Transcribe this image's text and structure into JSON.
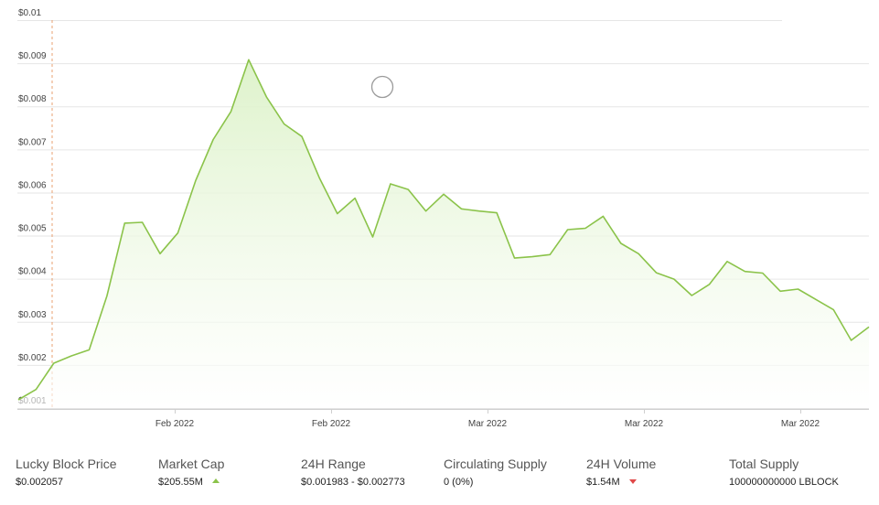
{
  "chart_data": {
    "type": "area",
    "title": "",
    "xlabel": "",
    "ylabel": "",
    "ylim": [
      0.001,
      0.01
    ],
    "y_ticks": [
      "$0.001",
      "$0.002",
      "$0.003",
      "$0.004",
      "$0.005",
      "$0.006",
      "$0.007",
      "$0.008",
      "$0.009",
      "$0.01"
    ],
    "x_ticks": [
      "Feb 2022",
      "Feb 2022",
      "Mar 2022",
      "Mar 2022",
      "Mar 2022"
    ],
    "grid": true,
    "series": [
      {
        "values": [
          0.00119,
          0.00143,
          0.00204,
          0.00221,
          0.00235,
          0.0036,
          0.00529,
          0.00531,
          0.00458,
          0.00506,
          0.00627,
          0.00723,
          0.00788,
          0.00908,
          0.00822,
          0.00759,
          0.0073,
          0.00633,
          0.00551,
          0.00587,
          0.00497,
          0.0062,
          0.00607,
          0.00557,
          0.00596,
          0.00562,
          0.00557,
          0.00553,
          0.00448,
          0.00451,
          0.00456,
          0.00514,
          0.00517,
          0.00545,
          0.00482,
          0.00458,
          0.00414,
          0.00399,
          0.00361,
          0.00387,
          0.0044,
          0.00417,
          0.00413,
          0.00371,
          0.00376,
          0.00352,
          0.00328,
          0.00257,
          0.00288
        ]
      }
    ],
    "colors": {
      "line": "#8bc34a",
      "fill_top": "#e3f5d1",
      "fill_bottom": "#ffffff",
      "marker": "#e8a070"
    }
  },
  "stats": [
    {
      "label": "Lucky Block Price",
      "value": "$0.002057",
      "trend": ""
    },
    {
      "label": "Market Cap",
      "value": "$205.55M",
      "trend": "up"
    },
    {
      "label": "24H Range",
      "value": "$0.001983 - $0.002773",
      "trend": ""
    },
    {
      "label": "Circulating Supply",
      "value": "0 (0%)",
      "trend": ""
    },
    {
      "label": "24H Volume",
      "value": "$1.54M",
      "trend": "down"
    },
    {
      "label": "Total Supply",
      "value": "100000000000 LBLOCK",
      "trend": ""
    }
  ]
}
